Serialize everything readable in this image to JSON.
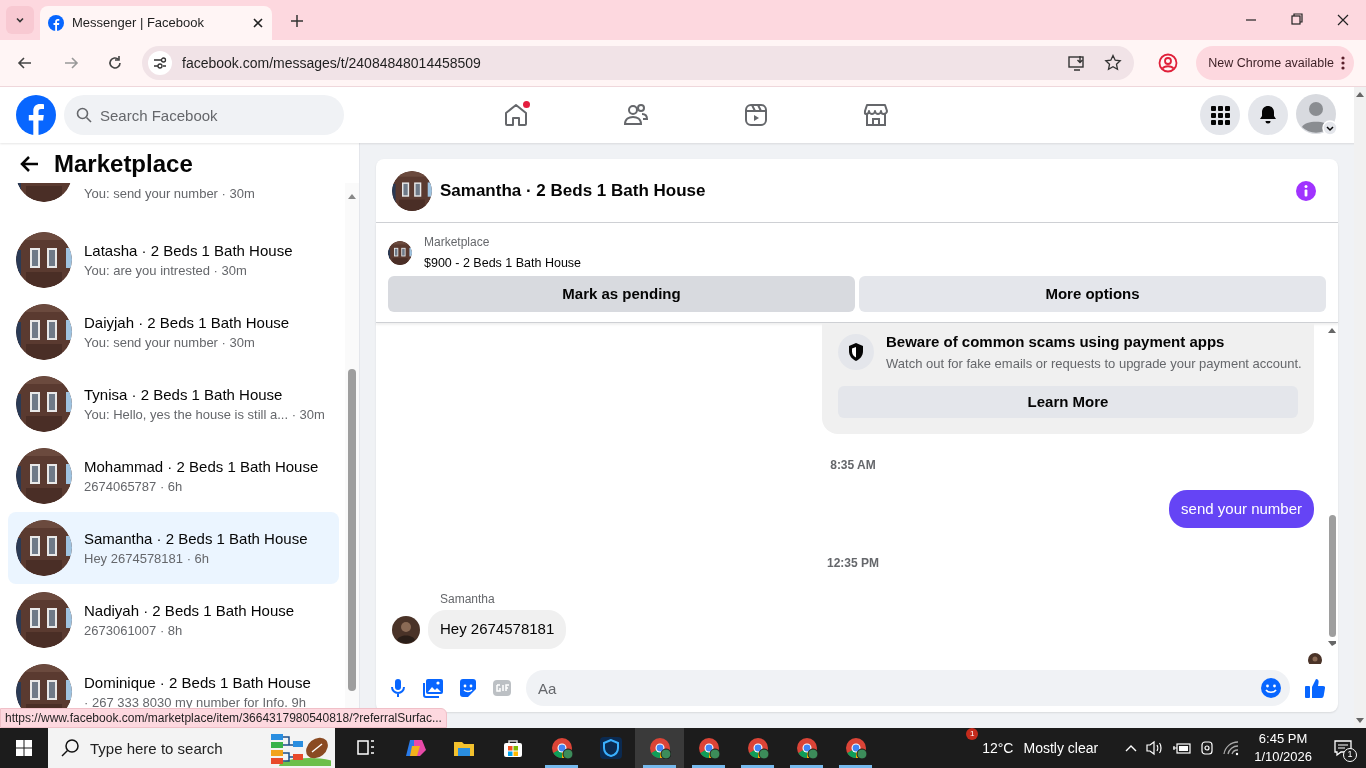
{
  "browser": {
    "tab_title": "Messenger | Facebook",
    "url": "facebook.com/messages/t/24084848014458509",
    "update_button": "New Chrome available",
    "status_url": "https://www.facebook.com/marketplace/item/3664317980540818/?referralSurfac..."
  },
  "header": {
    "search_placeholder": "Search Facebook",
    "nav": [
      {
        "kind": "home",
        "notification": true
      },
      {
        "kind": "friends",
        "notification": false
      },
      {
        "kind": "video",
        "notification": false
      },
      {
        "kind": "marketplace",
        "notification": false
      }
    ]
  },
  "sidebar": {
    "title": "Marketplace",
    "conversations": [
      {
        "preview": "You: send your number · 30m",
        "selected": false
      },
      {
        "name": "Latasha · 2 Beds 1 Bath House",
        "preview": "You: are you intrested · 30m",
        "selected": false
      },
      {
        "name": "Daiyjah · 2 Beds 1 Bath House",
        "preview": "You: send your number · 30m",
        "selected": false
      },
      {
        "name": "Tynisa · 2 Beds 1 Bath House",
        "preview": "You: Hello, yes the house is still a...  · 30m",
        "selected": false
      },
      {
        "name": "Mohammad · 2 Beds 1 Bath House",
        "preview": "2674065787 · 6h",
        "selected": false
      },
      {
        "name": "Samantha · 2 Beds 1 Bath House",
        "preview": "Hey 2674578181 · 6h",
        "selected": true
      },
      {
        "name": "Nadiyah · 2 Beds 1 Bath House",
        "preview": "2673061007 · 8h",
        "selected": false
      },
      {
        "name": "Dominique · 2 Beds 1 Bath House",
        "preview": "· 267 333 8030 my number for Info. 9h",
        "selected": false
      }
    ]
  },
  "chat": {
    "title": "Samantha · 2 Beds 1 Bath House",
    "listing": {
      "label": "Marketplace",
      "title": "$900 - 2 Beds 1 Bath House"
    },
    "buttons": [
      "Mark as pending",
      "More options"
    ],
    "messages": [
      {
        "kind": "notice",
        "title": "Beware of common scams using payment apps",
        "text": "Watch out for fake emails or requests to upgrade your payment account.",
        "button": "Learn More"
      },
      {
        "kind": "timestamp",
        "text": "8:35 AM"
      },
      {
        "kind": "outgoing",
        "text": "send your number"
      },
      {
        "kind": "timestamp",
        "text": "12:35 PM"
      },
      {
        "kind": "incoming",
        "sender": "Samantha",
        "text": "Hey 2674578181"
      }
    ],
    "composer_placeholder": "Aa"
  },
  "taskbar": {
    "search_placeholder": "Type here to search",
    "apps": [
      {
        "kind": "taskview",
        "running": false,
        "selected": false
      },
      {
        "kind": "copilot",
        "running": false,
        "selected": false
      },
      {
        "kind": "explorer",
        "running": false,
        "selected": false
      },
      {
        "kind": "store",
        "running": false,
        "selected": false
      },
      {
        "kind": "chrome",
        "running": true,
        "selected": false
      },
      {
        "kind": "shield",
        "running": false,
        "selected": false
      },
      {
        "kind": "chrome",
        "running": true,
        "selected": true
      },
      {
        "kind": "chrome",
        "running": true,
        "selected": false
      },
      {
        "kind": "chrome",
        "running": true,
        "selected": false
      },
      {
        "kind": "chrome",
        "running": true,
        "selected": false
      },
      {
        "kind": "chrome",
        "running": true,
        "selected": false
      }
    ],
    "weather_badge": "1",
    "temperature": "12°C",
    "weather": "Mostly clear",
    "time": "6:45 PM",
    "date": "1/10/2026",
    "notification_count": "1"
  }
}
